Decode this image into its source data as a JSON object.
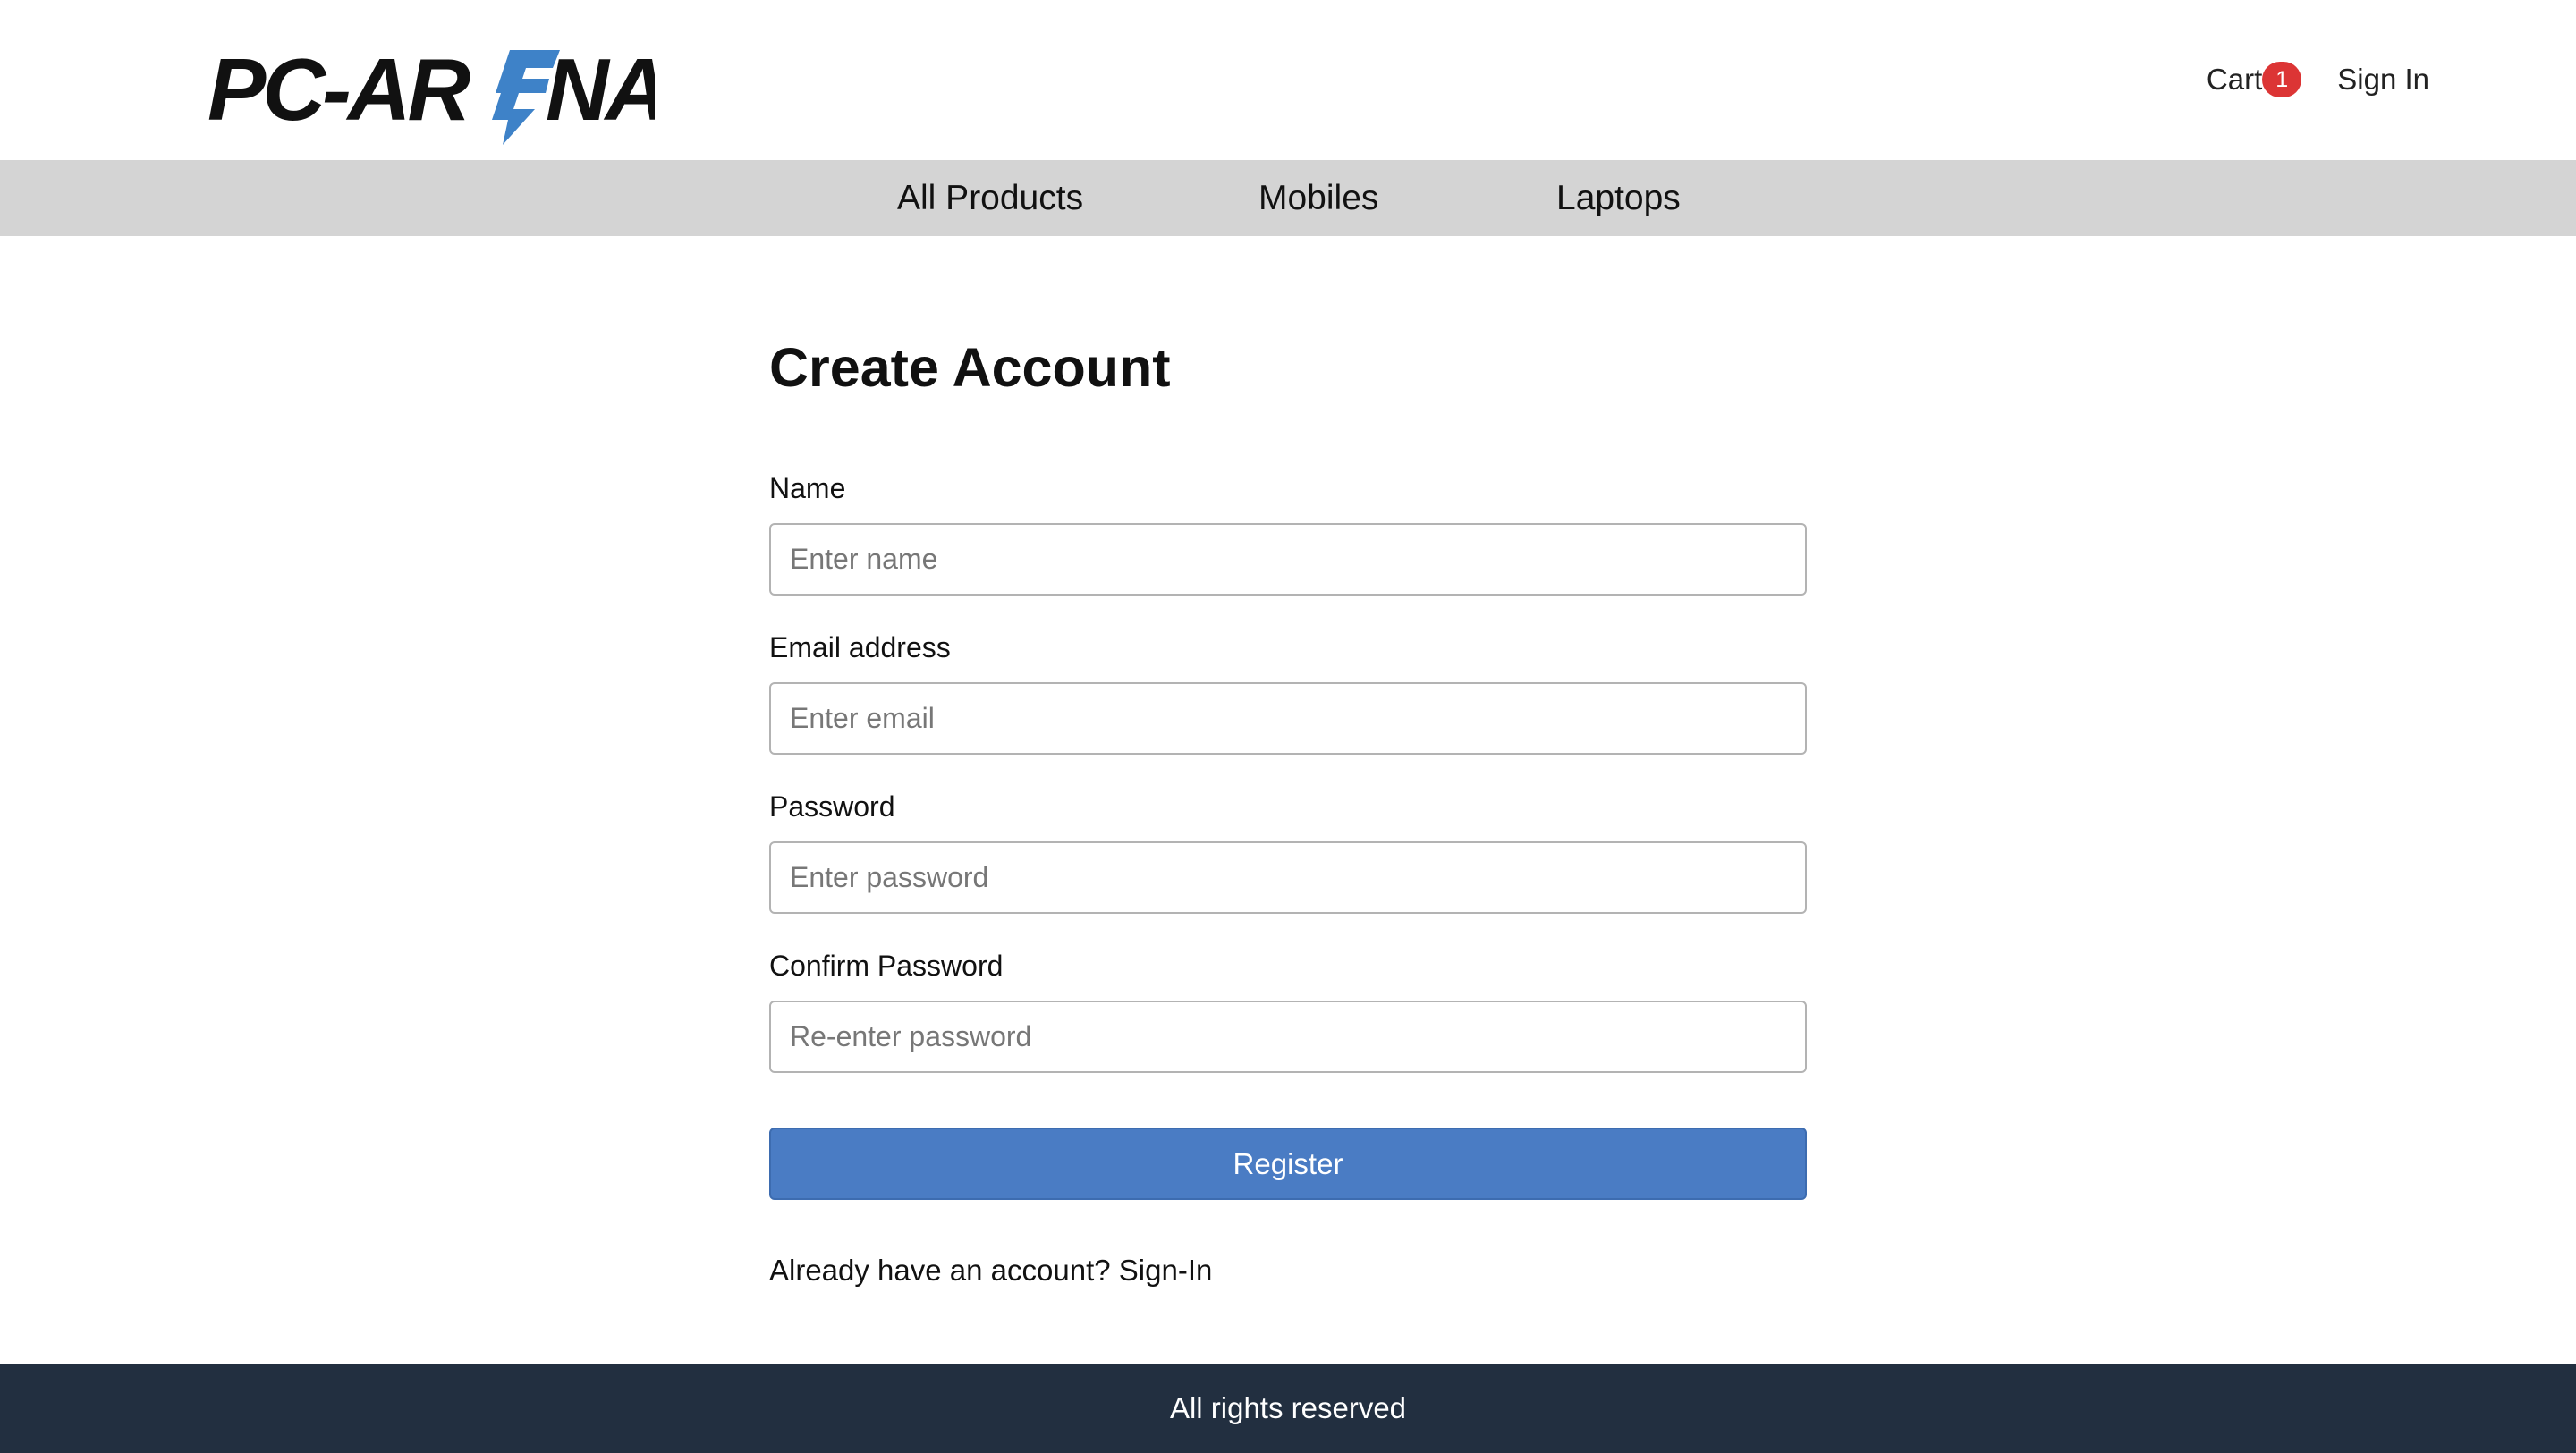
{
  "header": {
    "logo": {
      "text_left": "PC-AR",
      "text_right": "NA",
      "bolt_color": "#3e82c8",
      "text_color": "#111111"
    },
    "cart_label": "Cart",
    "cart_count": "1",
    "signin_label": "Sign In"
  },
  "nav": {
    "items": [
      "All Products",
      "Mobiles",
      "Laptops"
    ]
  },
  "form": {
    "title": "Create Account",
    "fields": [
      {
        "label": "Name",
        "placeholder": "Enter name"
      },
      {
        "label": "Email address",
        "placeholder": "Enter email"
      },
      {
        "label": "Password",
        "placeholder": "Enter password"
      },
      {
        "label": "Confirm Password",
        "placeholder": "Re-enter password"
      }
    ],
    "submit_label": "Register",
    "prompt_text": "Already have an account?",
    "prompt_link": "Sign-In"
  },
  "footer": {
    "text": "All rights reserved"
  },
  "colors": {
    "accent": "#4a7cc4",
    "badge": "#dc3535",
    "navbar_bg": "#d4d4d4",
    "footer_bg": "#222f40"
  }
}
